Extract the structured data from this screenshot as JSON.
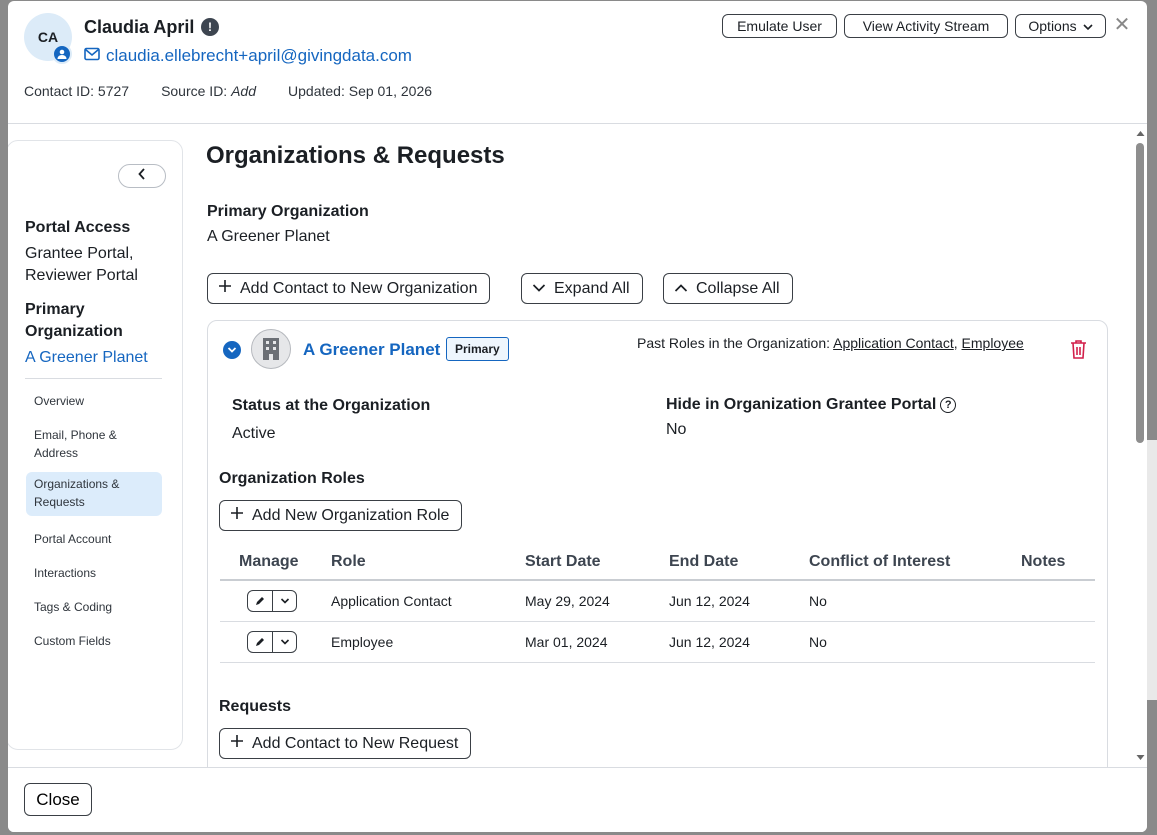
{
  "header": {
    "avatar_initials": "CA",
    "name": "Claudia April",
    "info_badge": "!",
    "email": "claudia.ellebrecht+april@givingdata.com",
    "contact_id": "Contact ID: 5727",
    "source_label": "Source ID:",
    "source_value": "Add",
    "updated": "Updated: Sep 01, 2026",
    "buttons": {
      "emulate": "Emulate User",
      "activity": "View Activity Stream",
      "options": "Options"
    },
    "close_glyph": "✕"
  },
  "sidebar": {
    "portal_access_label": "Portal Access",
    "portal_access_value_1": "Grantee Portal,",
    "portal_access_value_2": "Reviewer Portal",
    "primary_org_label_1": "Primary",
    "primary_org_label_2": "Organization",
    "primary_org_value": "A Greener Planet",
    "nav": [
      {
        "label": "Overview"
      },
      {
        "label": "Email, Phone &"
      },
      {
        "label": "Address"
      },
      {
        "label": "Organizations &"
      },
      {
        "label": "Requests"
      },
      {
        "label": "Portal Account"
      },
      {
        "label": "Interactions"
      },
      {
        "label": "Tags & Coding"
      },
      {
        "label": "Custom Fields"
      }
    ],
    "active_item": "Organizations & Requests"
  },
  "main": {
    "title": "Organizations & Requests",
    "primary_org_label": "Primary Organization",
    "primary_org_value": "A Greener Planet",
    "buttons": {
      "add_contact_org": "Add Contact to New Organization",
      "expand_all": "Expand All",
      "collapse_all": "Collapse All"
    },
    "org_card": {
      "name": "A Greener Planet",
      "tag": "Primary",
      "past_roles_prefix": "Past Roles in the Organization: ",
      "past_roles": [
        "Application Contact",
        "Employee"
      ],
      "past_roles_sep": ", ",
      "status_label": "Status at the Organization",
      "status_value": "Active",
      "hide_label": "Hide in Organization Grantee Portal",
      "hide_value": "No",
      "roles_heading": "Organization Roles",
      "add_role_button": "Add New Organization Role",
      "table": {
        "headers": [
          "Manage",
          "Role",
          "Start Date",
          "End Date",
          "Conflict of Interest",
          "Notes"
        ],
        "rows": [
          {
            "role": "Application Contact",
            "start": "May 29, 2024",
            "end": "Jun 12, 2024",
            "conflict": "No",
            "notes": ""
          },
          {
            "role": "Employee",
            "start": "Mar 01, 2024",
            "end": "Jun 12, 2024",
            "conflict": "No",
            "notes": ""
          }
        ]
      },
      "requests_heading": "Requests",
      "add_request_button": "Add Contact to New Request"
    }
  },
  "footer": {
    "close_button": "Close"
  },
  "colors": {
    "link": "#1566c0",
    "active_nav_bg": "#dcecfb",
    "trash": "#d21f4a"
  }
}
